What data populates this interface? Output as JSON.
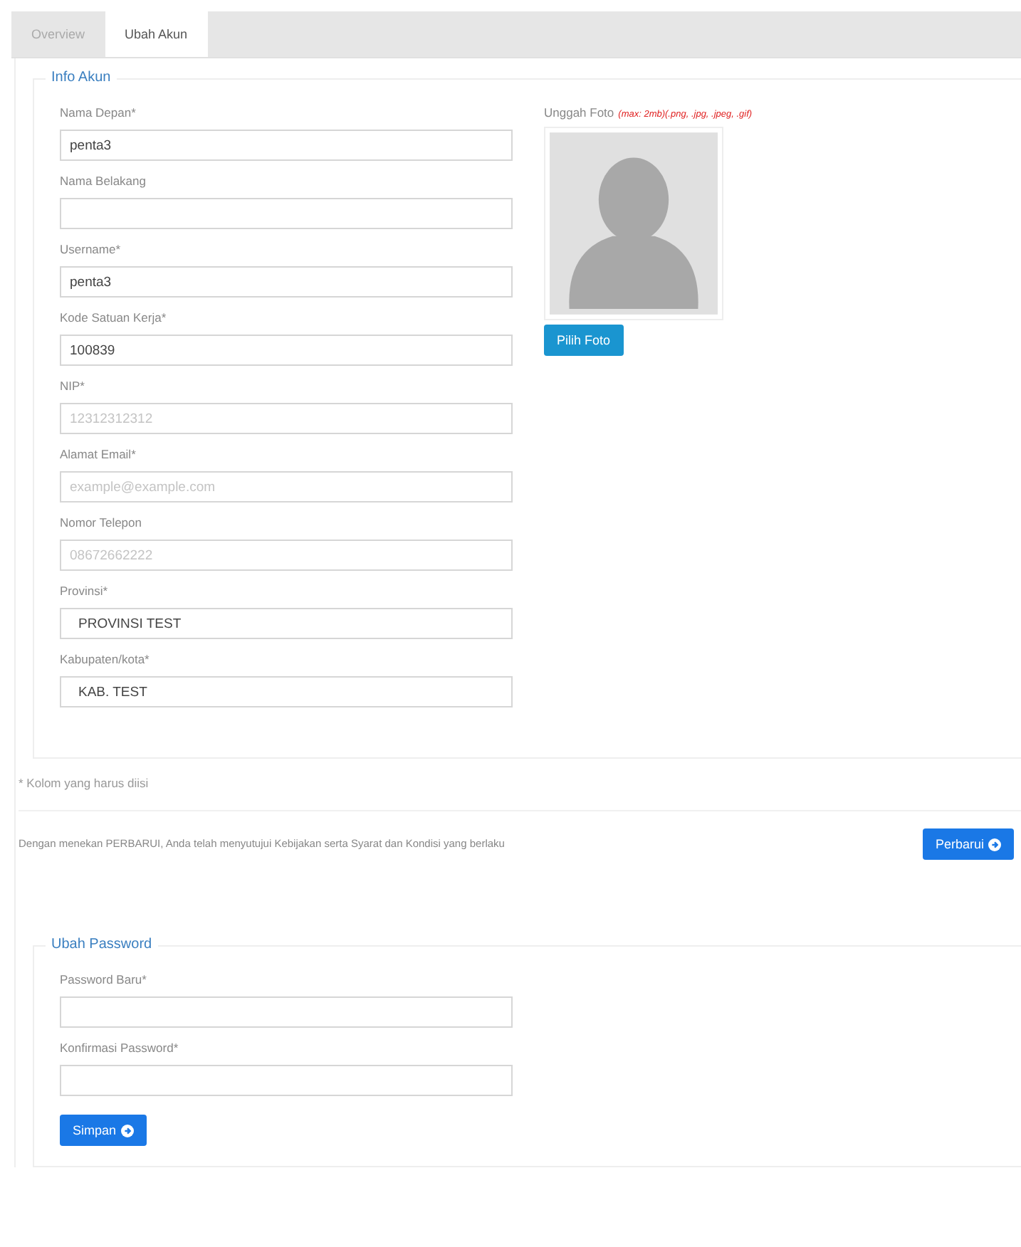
{
  "tabs": [
    {
      "label": "Overview",
      "selected": false
    },
    {
      "label": "Ubah Akun",
      "selected": true
    }
  ],
  "info_akun": {
    "legend": "Info Akun",
    "fields": [
      {
        "label": "Nama Depan*",
        "kind": "text",
        "value": "penta3"
      },
      {
        "label": "Nama Belakang",
        "kind": "text"
      },
      {
        "label": "Username*",
        "kind": "text",
        "value": "penta3"
      },
      {
        "label": "Kode Satuan Kerja*",
        "kind": "text",
        "value": "100839"
      },
      {
        "label": "NIP*",
        "kind": "text",
        "placeholder": "12312312312"
      },
      {
        "label": "Alamat Email*",
        "kind": "text",
        "placeholder": "example@example.com"
      },
      {
        "label": "Nomor Telepon",
        "kind": "text",
        "placeholder": "08672662222"
      },
      {
        "label": "Provinsi*",
        "kind": "select",
        "value": "PROVINSI TEST"
      },
      {
        "label": "Kabupaten/kota*",
        "kind": "select",
        "value": "KAB. TEST"
      }
    ],
    "upload": {
      "label": "Unggah Foto",
      "hint": "(max: 2mb)(.png, .jpg, .jpeg, .gif)",
      "button": "Pilih Foto"
    }
  },
  "required_note": "* Kolom yang harus diisi",
  "agreement": "Dengan menekan PERBARUI, Anda telah menyutujui Kebijakan serta Syarat dan Kondisi yang berlaku",
  "update_button": "Perbarui",
  "ubah_password": {
    "legend": "Ubah Password",
    "fields": [
      {
        "label": "Password Baru*"
      },
      {
        "label": "Konfirmasi Password*"
      }
    ],
    "button": "Simpan"
  }
}
